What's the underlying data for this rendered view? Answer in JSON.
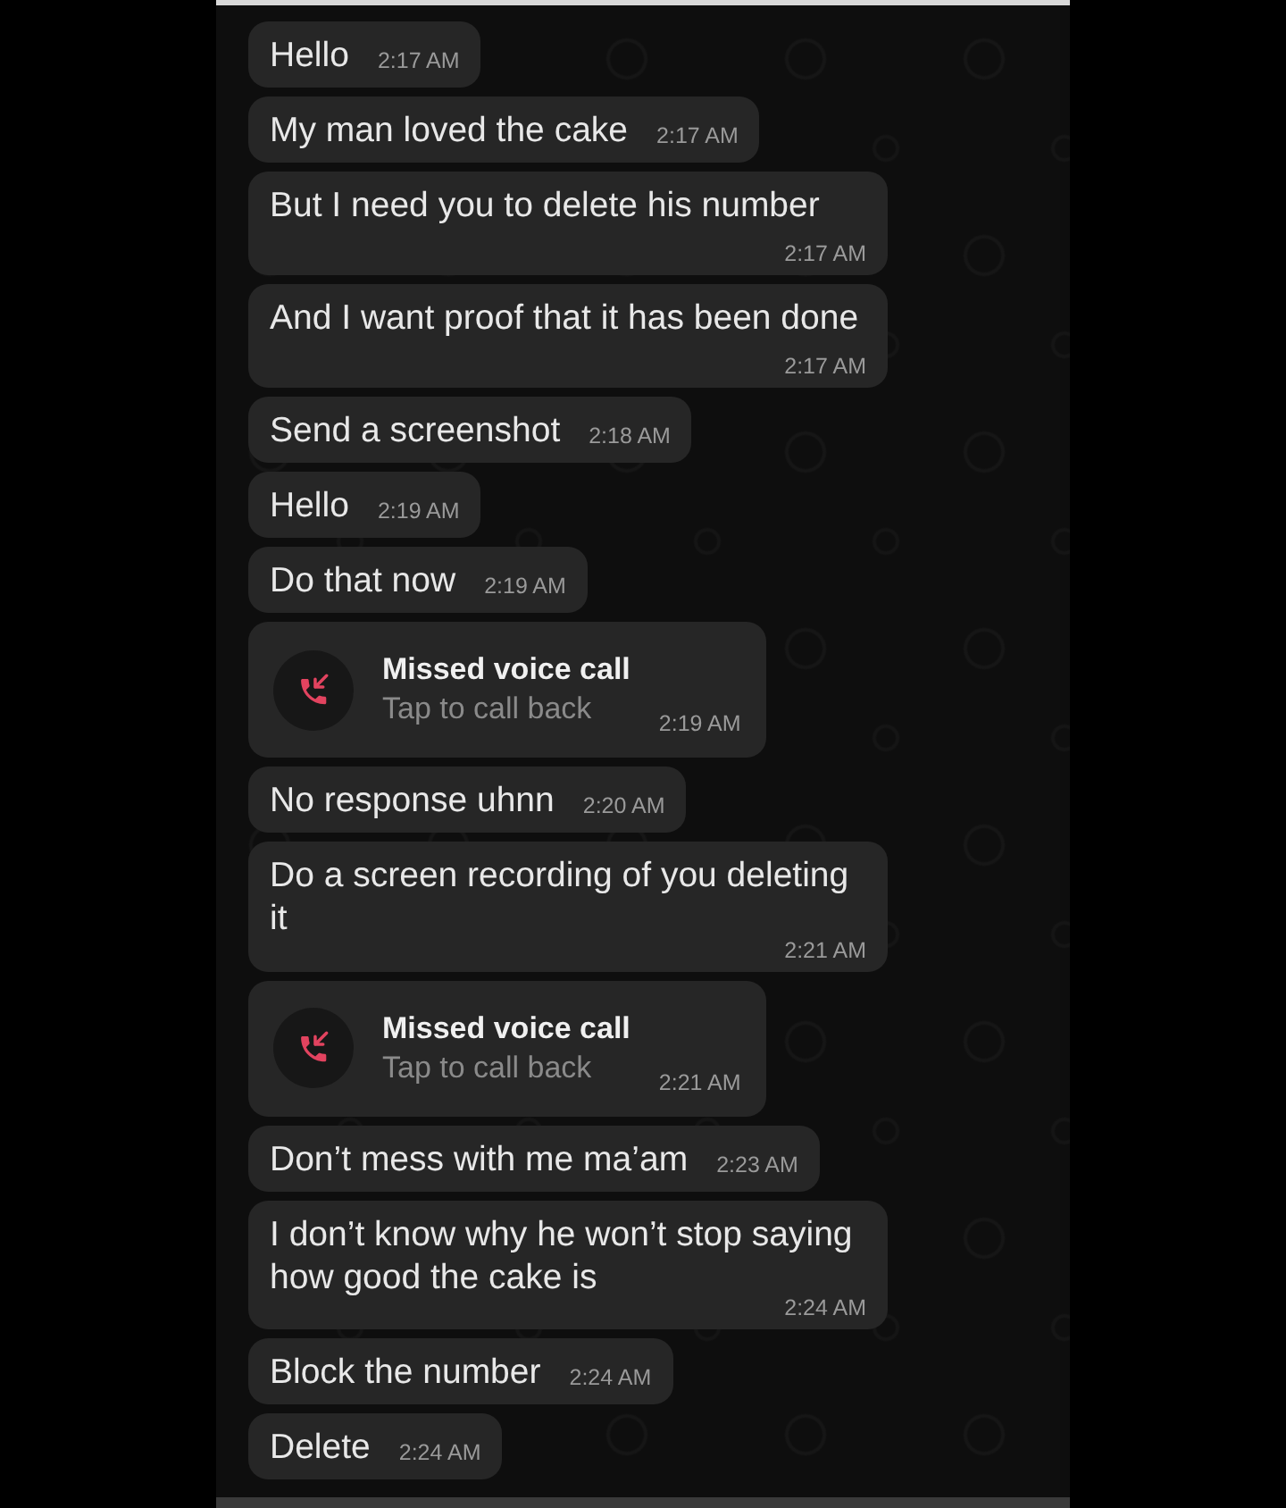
{
  "messages": [
    {
      "kind": "text",
      "text": "Hello",
      "time": "2:17 AM"
    },
    {
      "kind": "text",
      "text": "My man loved the cake",
      "time": "2:17 AM"
    },
    {
      "kind": "text",
      "text": "But I need you to delete his number",
      "time": "2:17 AM"
    },
    {
      "kind": "text",
      "text": "And I want proof that it has been done",
      "time": "2:17 AM"
    },
    {
      "kind": "text",
      "text": "Send a screenshot",
      "time": "2:18 AM"
    },
    {
      "kind": "text",
      "text": "Hello",
      "time": "2:19 AM"
    },
    {
      "kind": "text",
      "text": "Do that now",
      "time": "2:19 AM"
    },
    {
      "kind": "missed_call",
      "title": "Missed voice call",
      "subtitle": "Tap to call back",
      "time": "2:19 AM"
    },
    {
      "kind": "text",
      "text": "No response uhnn",
      "time": "2:20 AM"
    },
    {
      "kind": "text",
      "text": "Do a screen recording of you deleting it",
      "time": "2:21 AM"
    },
    {
      "kind": "missed_call",
      "title": "Missed voice call",
      "subtitle": "Tap to call back",
      "time": "2:21 AM"
    },
    {
      "kind": "text",
      "text": "Don’t mess with me ma’am",
      "time": "2:23 AM"
    },
    {
      "kind": "text",
      "text": "I don’t know why he won’t stop saying how good the cake is",
      "time": "2:24 AM"
    },
    {
      "kind": "text",
      "text": "Block the number",
      "time": "2:24 AM"
    },
    {
      "kind": "text",
      "text": "Delete",
      "time": "2:24 AM"
    }
  ]
}
